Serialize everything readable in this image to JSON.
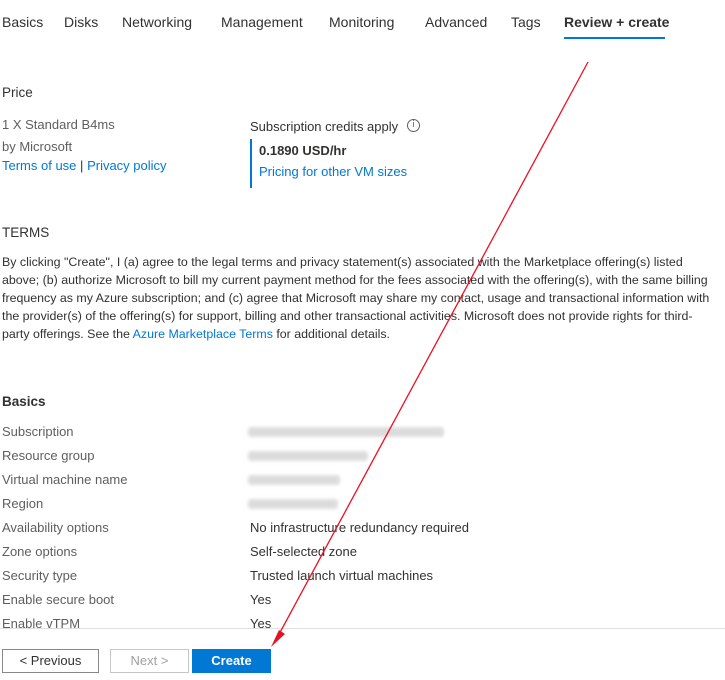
{
  "tabs": [
    {
      "label": "Basics"
    },
    {
      "label": "Disks"
    },
    {
      "label": "Networking"
    },
    {
      "label": "Management"
    },
    {
      "label": "Monitoring"
    },
    {
      "label": "Advanced"
    },
    {
      "label": "Tags"
    },
    {
      "label": "Review + create",
      "active": true
    }
  ],
  "price": {
    "heading": "Price",
    "product": "1 X Standard B4ms",
    "publisher": "by Microsoft",
    "terms_link": "Terms of use",
    "separator": "|",
    "privacy_link": "Privacy policy",
    "credits_label": "Subscription credits apply",
    "price_value": "0.1890 USD/hr",
    "pricing_link": "Pricing for other VM sizes"
  },
  "terms": {
    "heading": "TERMS",
    "text_before": "By clicking \"Create\", I (a) agree to the legal terms and privacy statement(s) associated with the Marketplace offering(s) listed above; (b) authorize Microsoft to bill my current payment method for the fees associated with the offering(s), with the same billing frequency as my Azure subscription; and (c) agree that Microsoft may share my contact, usage and transactional information with the provider(s) of the offering(s) for support, billing and other transactional activities. Microsoft does not provide rights for third-party offerings. See the ",
    "link": "Azure Marketplace Terms",
    "text_after": " for additional details."
  },
  "basics": {
    "heading": "Basics",
    "rows": [
      {
        "label": "Subscription",
        "value": ""
      },
      {
        "label": "Resource group",
        "value": ""
      },
      {
        "label": "Virtual machine name",
        "value": ""
      },
      {
        "label": "Region",
        "value": ""
      },
      {
        "label": "Availability options",
        "value": "No infrastructure redundancy required"
      },
      {
        "label": "Zone options",
        "value": "Self-selected zone"
      },
      {
        "label": "Security type",
        "value": "Trusted launch virtual machines"
      },
      {
        "label": "Enable secure boot",
        "value": "Yes"
      },
      {
        "label": "Enable vTPM",
        "value": "Yes"
      }
    ]
  },
  "footer": {
    "previous": "< Previous",
    "next": "Next >",
    "create": "Create"
  },
  "colors": {
    "accent": "#0078d4",
    "annotation_arrow": "#e81123"
  }
}
